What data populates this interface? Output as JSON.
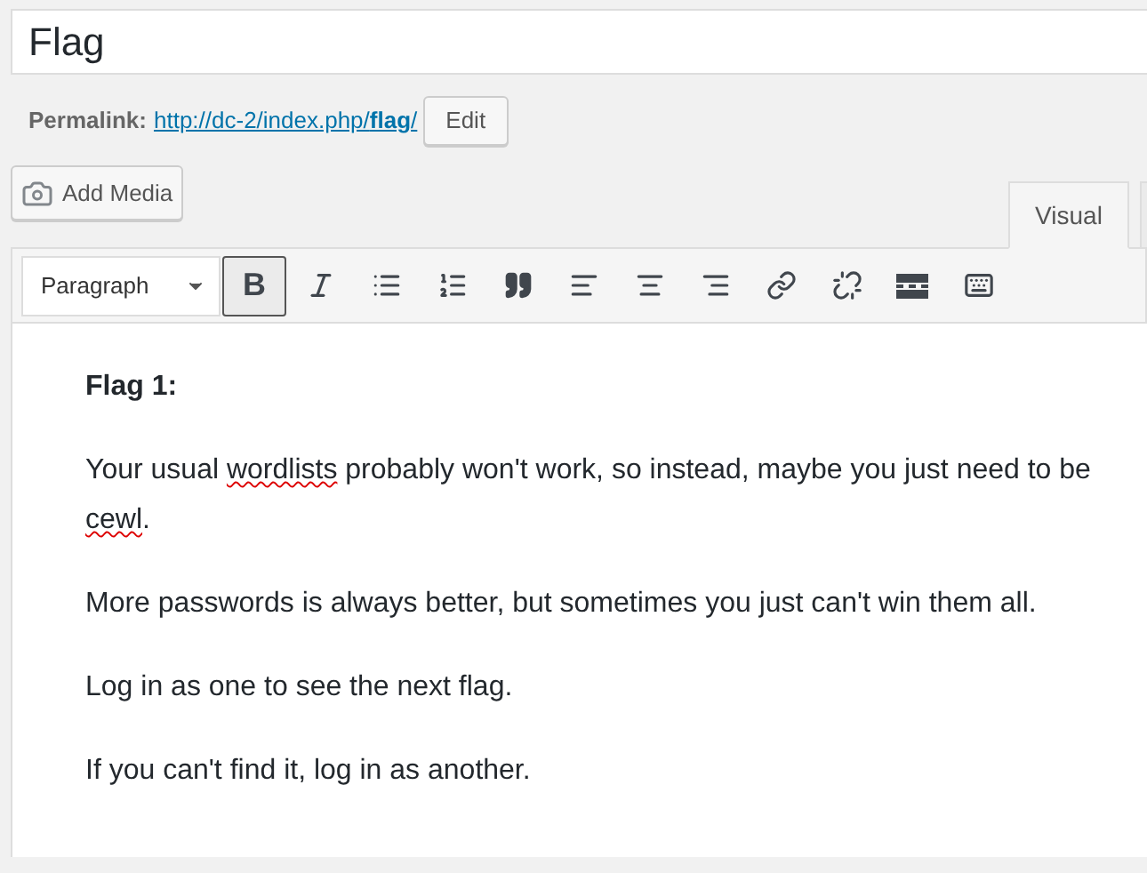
{
  "title_field": {
    "value": "Flag"
  },
  "permalink": {
    "label": "Permalink:",
    "url_base": "http://dc-2/index.php/",
    "slug": "flag",
    "trailing": "/",
    "edit_button": "Edit"
  },
  "add_media_button": "Add Media",
  "tabs": [
    {
      "label": "Visual",
      "selected": true
    }
  ],
  "toolbar": {
    "format_select": "Paragraph",
    "buttons": [
      {
        "kind": "bold",
        "label": "B",
        "selected": true
      },
      {
        "kind": "italic",
        "selected": false
      },
      {
        "kind": "bullet-list",
        "selected": false
      },
      {
        "kind": "numbered-list",
        "selected": false
      },
      {
        "kind": "quote",
        "selected": false
      },
      {
        "kind": "align-left",
        "selected": false
      },
      {
        "kind": "align-center",
        "selected": false
      },
      {
        "kind": "align-right",
        "selected": false
      },
      {
        "kind": "link",
        "selected": false
      },
      {
        "kind": "unlink",
        "selected": false
      },
      {
        "kind": "read-more",
        "selected": false
      },
      {
        "kind": "toolbar-toggle",
        "selected": false
      }
    ]
  },
  "content": [
    {
      "kind": "heading",
      "text": "Flag 1:"
    },
    {
      "kind": "paragraph",
      "segments": [
        {
          "text": "Your usual ",
          "misspelled": false
        },
        {
          "text": "wordlists",
          "misspelled": true
        },
        {
          "text": " probably won't work, so instead, maybe you just need to be ",
          "misspelled": false
        },
        {
          "text": "cewl",
          "misspelled": true
        },
        {
          "text": ".",
          "misspelled": false
        }
      ]
    },
    {
      "kind": "paragraph",
      "segments": [
        {
          "text": "More passwords is always better, but sometimes you just can't win them all.",
          "misspelled": false
        }
      ]
    },
    {
      "kind": "paragraph",
      "segments": [
        {
          "text": "Log in as one to see the next flag.",
          "misspelled": false
        }
      ]
    },
    {
      "kind": "paragraph",
      "segments": [
        {
          "text": "If you can't find it, log in as another.",
          "misspelled": false
        }
      ]
    }
  ]
}
